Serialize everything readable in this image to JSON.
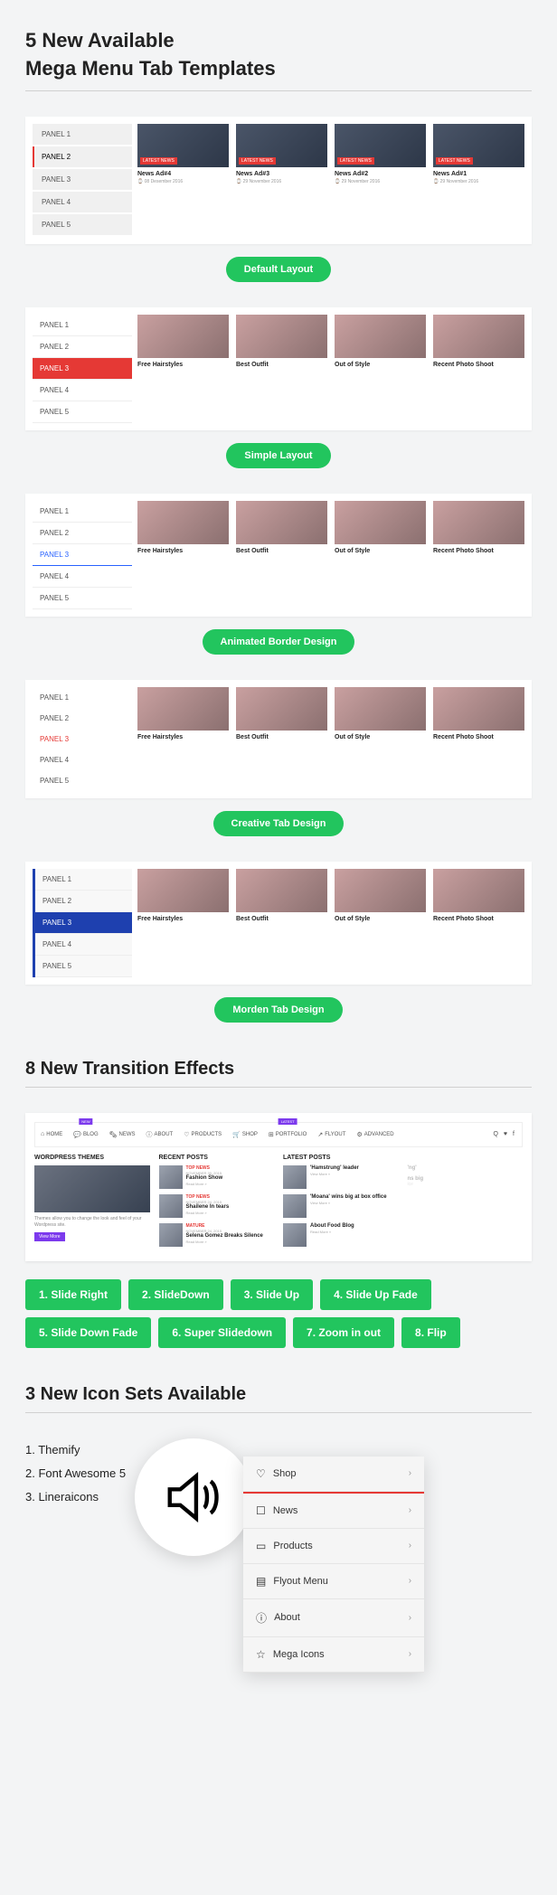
{
  "section1": {
    "title_line1": "5 New Available",
    "title_line2": "Mega Menu Tab Templates",
    "tabs": [
      "PANEL 1",
      "PANEL 2",
      "PANEL 3",
      "PANEL 4",
      "PANEL 5"
    ],
    "demos": [
      {
        "active": 1,
        "label": "Default Layout",
        "news": true,
        "cards": [
          {
            "title": "News Ad#4",
            "date": "08 Desember 2016",
            "badge": "LATEST NEWS"
          },
          {
            "title": "News Ad#3",
            "date": "29 November 2016",
            "badge": "LATEST NEWS"
          },
          {
            "title": "News Ad#2",
            "date": "29 November 2016",
            "badge": "LATEST NEWS"
          },
          {
            "title": "News Ad#1",
            "date": "29 November 2016",
            "badge": "LATEST NEWS"
          }
        ]
      },
      {
        "active": 2,
        "label": "Simple Layout",
        "cards": [
          {
            "title": "Free Hairstyles"
          },
          {
            "title": "Best Outfit"
          },
          {
            "title": "Out of Style"
          },
          {
            "title": "Recent Photo Shoot"
          }
        ]
      },
      {
        "active": 2,
        "label": "Animated Border Design",
        "cards": [
          {
            "title": "Free Hairstyles"
          },
          {
            "title": "Best Outfit"
          },
          {
            "title": "Out of Style"
          },
          {
            "title": "Recent Photo Shoot"
          }
        ]
      },
      {
        "active": 2,
        "label": "Creative Tab Design",
        "cards": [
          {
            "title": "Free Hairstyles"
          },
          {
            "title": "Best Outfit"
          },
          {
            "title": "Out of Style"
          },
          {
            "title": "Recent Photo Shoot"
          }
        ]
      },
      {
        "active": 2,
        "label": "Morden Tab Design",
        "cards": [
          {
            "title": "Free Hairstyles"
          },
          {
            "title": "Best Outfit"
          },
          {
            "title": "Out of Style"
          },
          {
            "title": "Recent Photo Shoot"
          }
        ]
      }
    ]
  },
  "section2": {
    "title": "8 New Transition Effects",
    "nav": [
      "HOME",
      "BLOG",
      "NEWS",
      "ABOUT",
      "PRODUCTS",
      "SHOP",
      "PORTFOLIO",
      "FLYOUT",
      "ADVANCED"
    ],
    "tag_new": "NEW",
    "tag_latest": "LATEST",
    "col1": {
      "head": "WORDPRESS THEMES",
      "text": "Themes allow you to change the look and feel of your Wordpress site.",
      "btn": "View More"
    },
    "col2": {
      "head": "RECENT POSTS",
      "posts": [
        {
          "cat": "TOP NEWS",
          "date": "NOVEMBER 30, 2015",
          "title": "Fashion Show",
          "rm": "Read More »"
        },
        {
          "cat": "TOP NEWS",
          "date": "NOVEMBER 24, 2015",
          "title": "Shailene In tears",
          "rm": "Read More »"
        },
        {
          "cat": "MATURE",
          "date": "NOVEMBER 24, 2015",
          "title": "Selena Gomez Breaks Silence",
          "rm": "Read More »"
        }
      ]
    },
    "col3": {
      "head": "LATEST POSTS",
      "posts": [
        {
          "title": "'Hamstrung' leader",
          "rm": "View More »"
        },
        {
          "title": "'Moana' wins big at box office",
          "rm": "View More »"
        },
        {
          "title": "About Food Blog",
          "rm": "Read More »"
        }
      ]
    },
    "effects": [
      "1. Slide Right",
      "2. SlideDown",
      "3. Slide Up",
      "4. Slide Up Fade",
      "5. Slide Down Fade",
      "6. Super Slidedown",
      "7. Zoom in out",
      "8. Flip"
    ]
  },
  "section3": {
    "title": "3 New Icon Sets Available",
    "list": [
      "1. Themify",
      "2. Font Awesome 5",
      "3. Lineraicons"
    ],
    "menu": [
      {
        "icon": "♡",
        "label": "Shop"
      },
      {
        "icon": "☐",
        "label": "News"
      },
      {
        "icon": "▭",
        "label": "Products"
      },
      {
        "icon": "▤",
        "label": "Flyout Menu"
      },
      {
        "icon": "ⓘ",
        "label": "About"
      },
      {
        "icon": "☆",
        "label": "Mega Icons"
      }
    ]
  }
}
